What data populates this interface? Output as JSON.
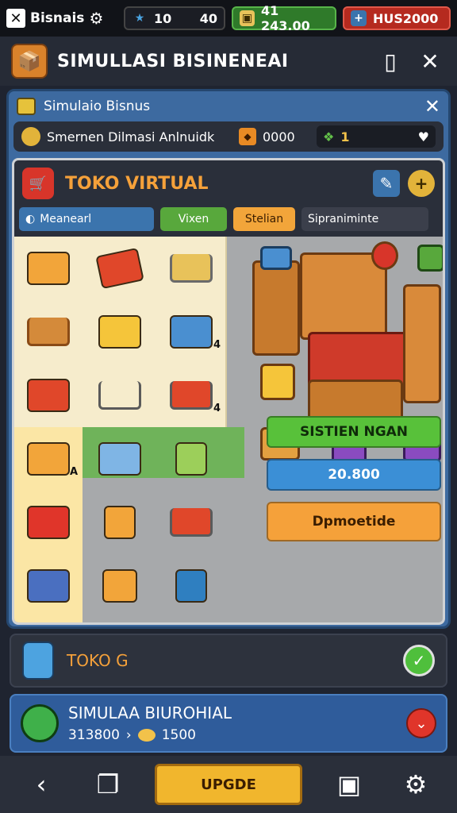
{
  "statusbar": {
    "brand": "Bisnais",
    "energy": {
      "icon": "star-icon",
      "value": "10",
      "extra": "40"
    },
    "cash": {
      "icon": "cash-icon",
      "value": "41  243.00"
    },
    "gems": {
      "icon": "plus-icon",
      "value": "HUS2000"
    }
  },
  "header": {
    "title": "SIMULLASI BISINENEAI"
  },
  "panel": {
    "title": "Simulaio Bisnus",
    "subbar": {
      "text": "Smernen Dilmasi Anlnuidk",
      "value": "0000",
      "level": "1"
    }
  },
  "store": {
    "title": "TOKO VIRTUAL",
    "tabs": [
      {
        "label": "Meanearl",
        "color": "#3b74ad"
      },
      {
        "label": "Vixen",
        "color": "#58a83c"
      },
      {
        "label": "Stelian",
        "color": "#f2a53a"
      },
      {
        "label": "Sipraniminte",
        "color": "#3b3f4b"
      }
    ],
    "grid_badges": [
      "4",
      "4",
      "A"
    ]
  },
  "actions": {
    "primary": "SISTIEN NGAN",
    "value": "20.800",
    "secondary": "Dpmoetide"
  },
  "row1": {
    "title": "TOKO G"
  },
  "row2": {
    "title": "SIMULAA BIUROHIAL",
    "left_value": "313800",
    "right_value": "1500"
  },
  "navbar": {
    "upgrade": "UPGDE"
  },
  "colors": {
    "accent": "#f5a13a",
    "panel": "#3d6aa0",
    "green": "#58a83c"
  }
}
